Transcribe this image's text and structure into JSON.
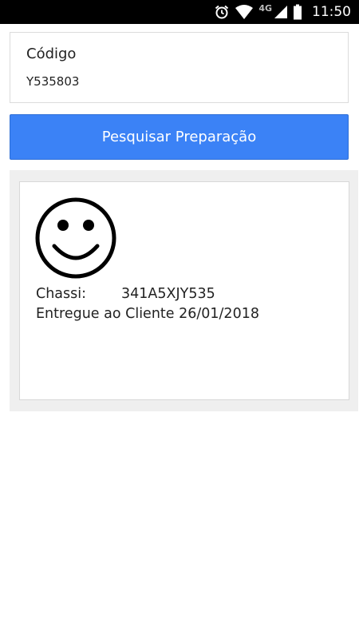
{
  "status_bar": {
    "network": "4G",
    "time": "11:50",
    "icons": [
      "alarm-icon",
      "wifi-icon",
      "cell-signal-icon",
      "battery-icon"
    ]
  },
  "code_field": {
    "label": "Código",
    "value": "Y535803"
  },
  "search_button": {
    "label": "Pesquisar Preparação",
    "color": "#3b82f6"
  },
  "result": {
    "icon": "smiley-face-icon",
    "chassi_label": "Chassi:",
    "chassi_value": "341A5XJY535",
    "delivery_text": "Entregue ao Cliente 26/01/2018"
  }
}
